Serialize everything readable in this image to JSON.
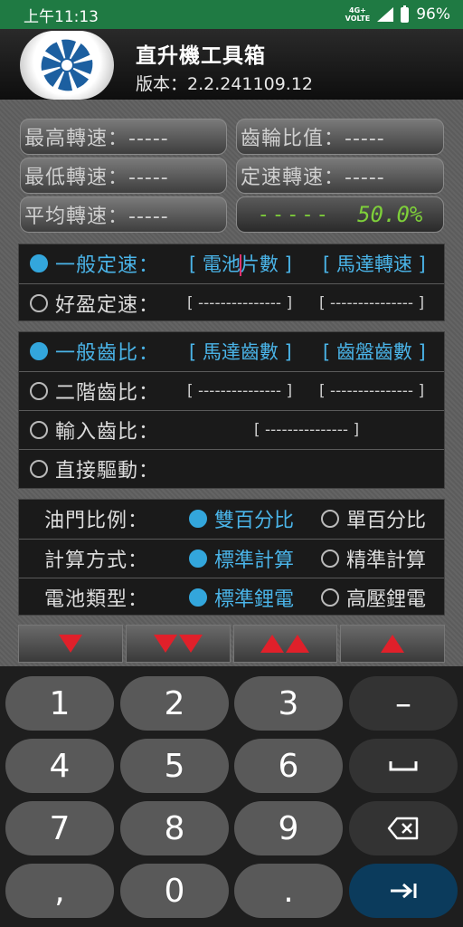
{
  "status_bar": {
    "time": "上午11:13",
    "network": "4G+",
    "network_sub": "VOLTE",
    "battery": "96%"
  },
  "header": {
    "title": "直升機工具箱",
    "version": "版本：2.2.241109.12"
  },
  "stats": {
    "max_rpm": "最高轉速：-----",
    "gear_ratio": "齒輪比值：-----",
    "min_rpm": "最低轉速：-----",
    "governor_rpm": "定速轉速：-----",
    "avg_rpm": "平均轉速：-----",
    "lcd_value": "-----",
    "lcd_percent": "50.0%"
  },
  "governor_mode": {
    "rows": [
      {
        "label": "一般定速：",
        "field1_pre": "[ 電池",
        "field1_post": "片數 ]",
        "field2": "[ 馬達轉速 ]",
        "selected": true
      },
      {
        "label": "好盈定速：",
        "field1": "[ --------------- ]",
        "field2": "[ --------------- ]",
        "selected": false
      }
    ]
  },
  "gear_mode": {
    "rows": [
      {
        "label": "一般齒比：",
        "field1": "[ 馬達齒數 ]",
        "field2": "[ 齒盤齒數 ]",
        "selected": true
      },
      {
        "label": "二階齒比：",
        "field1": "[ --------------- ]",
        "field2": "[ --------------- ]",
        "selected": false
      },
      {
        "label": "輸入齒比：",
        "field1": "[ --------------- ]",
        "selected": false
      },
      {
        "label": "直接驅動：",
        "selected": false
      }
    ]
  },
  "settings": [
    {
      "label": "油門比例：",
      "opt1": "雙百分比",
      "opt2": "單百分比",
      "selected": 1
    },
    {
      "label": "計算方式：",
      "opt1": "標準計算",
      "opt2": "精準計算",
      "selected": 1
    },
    {
      "label": "電池類型：",
      "opt1": "標準鋰電",
      "opt2": "高壓鋰電",
      "selected": 1
    }
  ],
  "arrow_buttons": [
    "down",
    "double-down",
    "double-up",
    "up"
  ],
  "keypad": {
    "keys": [
      "1",
      "2",
      "3",
      "–",
      "4",
      "5",
      "6",
      "␣",
      "7",
      "8",
      "9",
      "backspace",
      ",",
      "0",
      ".",
      "→|"
    ]
  },
  "colors": {
    "accent": "#33a6dc",
    "lcd": "#7ecf3a",
    "arrow": "#e0202a",
    "status_bar": "#1f7a43"
  }
}
